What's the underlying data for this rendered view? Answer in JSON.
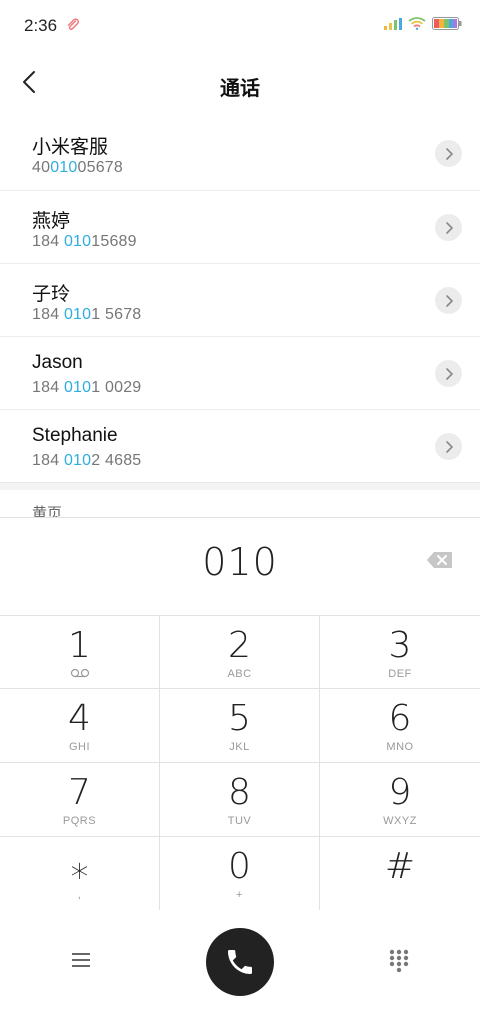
{
  "status_bar": {
    "time": "2:36",
    "icons": [
      "paperclip-icon",
      "signal-icon",
      "wifi-icon",
      "battery-icon"
    ]
  },
  "header": {
    "title": "通话",
    "back_icon": "chevron-left-icon"
  },
  "contacts": [
    {
      "name": "小米客服",
      "number_pre": "40",
      "number_match": "010",
      "number_post": "05678"
    },
    {
      "name": "燕婷",
      "number_pre": "184 ",
      "number_match": "010",
      "number_post": "15689"
    },
    {
      "name": "子玲",
      "number_pre": "184 ",
      "number_match": "010",
      "number_post": "1 5678"
    },
    {
      "name": "Jason",
      "number_pre": "184 ",
      "number_match": "010",
      "number_post": "1 0029"
    },
    {
      "name": "Stephanie",
      "number_pre": "184 ",
      "number_match": "010",
      "number_post": "2 4685"
    }
  ],
  "section_label": "黄页",
  "dialer": {
    "display": "010"
  },
  "keypad": [
    {
      "digit": "1",
      "sub": "voicemail"
    },
    {
      "digit": "2",
      "sub": "ABC"
    },
    {
      "digit": "3",
      "sub": "DEF"
    },
    {
      "digit": "4",
      "sub": "GHI"
    },
    {
      "digit": "5",
      "sub": "JKL"
    },
    {
      "digit": "6",
      "sub": "MNO"
    },
    {
      "digit": "7",
      "sub": "PQRS"
    },
    {
      "digit": "8",
      "sub": "TUV"
    },
    {
      "digit": "9",
      "sub": "WXYZ"
    },
    {
      "digit": "⁎",
      "sub": ","
    },
    {
      "digit": "0",
      "sub": "+"
    },
    {
      "digit": "#",
      "sub": ""
    }
  ],
  "colors": {
    "match_highlight": "#2eaee0",
    "call_button": "#222222",
    "divider": "#e2e2e2"
  }
}
